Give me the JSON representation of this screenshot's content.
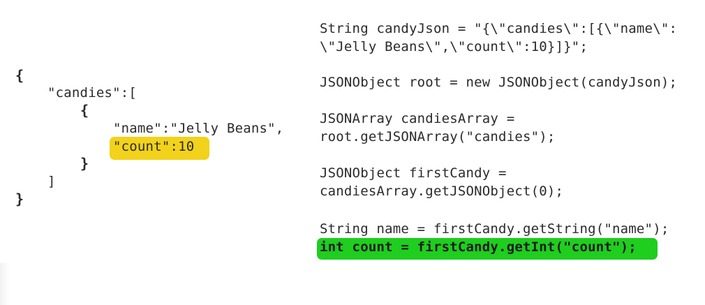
{
  "json_example": {
    "open_root": "{",
    "candies_key": "\"candies\":[",
    "open_item": "{",
    "name_pair": "\"name\":\"Jelly Beans\",",
    "count_pair": "\"count\":10",
    "close_item": "}",
    "close_array": "]",
    "close_root": "}"
  },
  "java_code": {
    "line1": "String candyJson = \"{\\\"candies\\\":[{\\\"name\\\":",
    "line2": "\\\"Jelly Beans\\\",\\\"count\\\":10}]}\";",
    "line3": "JSONObject root = new JSONObject(candyJson);",
    "line4": "JSONArray candiesArray =",
    "line5": "root.getJSONArray(\"candies\");",
    "line6": "JSONObject firstCandy =",
    "line7": "candiesArray.getJSONObject(0);",
    "line8": "String name = firstCandy.getString(\"name\");",
    "line9": "int count = firstCandy.getInt(\"count\");"
  },
  "colors": {
    "highlight_json": "#f2d21a",
    "highlight_java": "#1fce1f"
  }
}
